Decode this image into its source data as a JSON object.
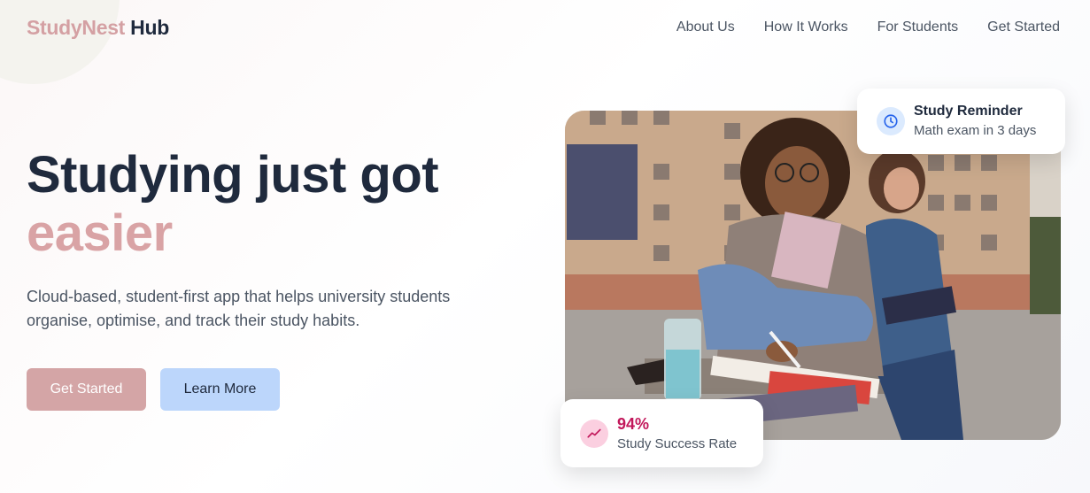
{
  "header": {
    "logo_brand": "StudyNest",
    "logo_suffix": "Hub",
    "nav": [
      "About Us",
      "How It Works",
      "For Students",
      "Get Started"
    ]
  },
  "hero": {
    "title_line1": "Studying just got",
    "title_accent": "easier",
    "description": "Cloud-based, student-first app that helps university students organise, optimise, and track their study habits.",
    "primary_button": "Get Started",
    "secondary_button": "Learn More"
  },
  "reminder_card": {
    "icon": "clock-icon",
    "title": "Study Reminder",
    "subtitle": "Math exam in 3 days"
  },
  "success_card": {
    "icon": "trending-up-icon",
    "value": "94%",
    "label": "Study Success Rate"
  },
  "colors": {
    "accent_pink": "#d4a5a6",
    "accent_blue": "#bcd6fb",
    "dark_text": "#1f2a3d",
    "success_value": "#c2185b"
  }
}
